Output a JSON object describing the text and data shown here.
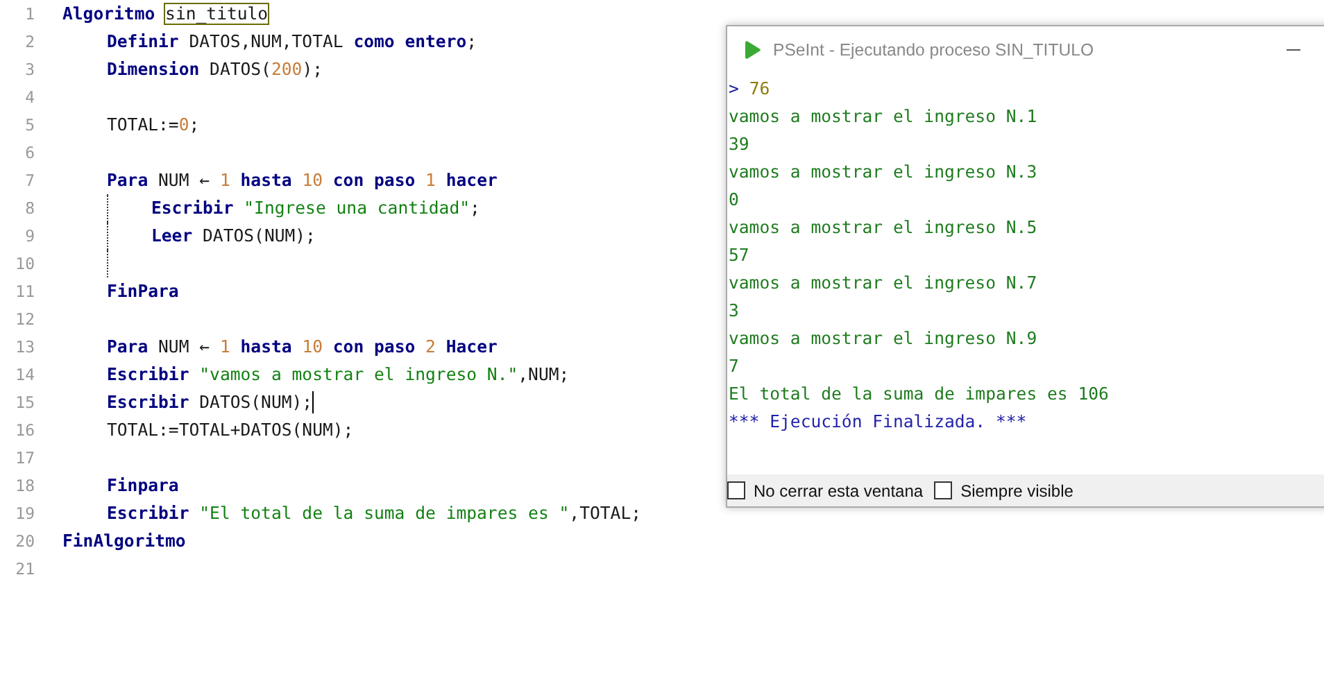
{
  "editor": {
    "lines": [
      {
        "number": "1",
        "tokens": [
          {
            "kind": "keyword",
            "text": "Algoritmo "
          },
          {
            "kind": "match",
            "text": "sin_titulo"
          }
        ],
        "children": [
          {
            "number": "2",
            "tokens": [
              {
                "kind": "keyword",
                "text": "Definir"
              },
              {
                "kind": "plain",
                "text": " DATOS,NUM,TOTAL "
              },
              {
                "kind": "keyword",
                "text": "como entero"
              },
              {
                "kind": "plain",
                "text": ";"
              }
            ]
          },
          {
            "number": "3",
            "tokens": [
              {
                "kind": "keyword",
                "text": "Dimension"
              },
              {
                "kind": "plain",
                "text": " DATOS("
              },
              {
                "kind": "number",
                "text": "200"
              },
              {
                "kind": "plain",
                "text": ");"
              }
            ]
          },
          {
            "number": "4"
          },
          {
            "number": "5",
            "tokens": [
              {
                "kind": "plain",
                "text": "TOTAL:="
              },
              {
                "kind": "number",
                "text": "0"
              },
              {
                "kind": "plain",
                "text": ";"
              }
            ]
          },
          {
            "number": "6"
          },
          {
            "number": "7",
            "tokens": [
              {
                "kind": "keyword",
                "text": "Para"
              },
              {
                "kind": "plain",
                "text": " NUM ← "
              },
              {
                "kind": "number",
                "text": "1 "
              },
              {
                "kind": "keyword",
                "text": "hasta "
              },
              {
                "kind": "number",
                "text": "10 "
              },
              {
                "kind": "keyword",
                "text": "con paso "
              },
              {
                "kind": "number",
                "text": "1 "
              },
              {
                "kind": "keyword",
                "text": "hacer"
              }
            ],
            "children": [
              {
                "number": "8",
                "tokens": [
                  {
                    "kind": "keyword",
                    "text": "Escribir "
                  },
                  {
                    "kind": "string",
                    "text": "\"Ingrese una cantidad\""
                  },
                  {
                    "kind": "plain",
                    "text": ";"
                  }
                ]
              },
              {
                "number": "9",
                "tokens": [
                  {
                    "kind": "keyword",
                    "text": "Leer"
                  },
                  {
                    "kind": "plain",
                    "text": " DATOS(NUM);"
                  }
                ]
              },
              {
                "number": "10"
              }
            ]
          },
          {
            "number": "11",
            "tokens": [
              {
                "kind": "keyword",
                "text": "FinPara"
              }
            ]
          },
          {
            "number": "12"
          },
          {
            "number": "13",
            "tokens": [
              {
                "kind": "keyword",
                "text": "Para"
              },
              {
                "kind": "plain",
                "text": " NUM ← "
              },
              {
                "kind": "number",
                "text": "1 "
              },
              {
                "kind": "keyword",
                "text": "hasta "
              },
              {
                "kind": "number",
                "text": "10 "
              },
              {
                "kind": "keyword",
                "text": "con paso "
              },
              {
                "kind": "number",
                "text": "2 "
              },
              {
                "kind": "keyword",
                "text": "Hacer"
              }
            ]
          },
          {
            "number": "14",
            "tokens": [
              {
                "kind": "keyword",
                "text": "Escribir "
              },
              {
                "kind": "string",
                "text": "\"vamos a mostrar el ingreso N.\""
              },
              {
                "kind": "plain",
                "text": ",NUM;"
              }
            ]
          },
          {
            "number": "15",
            "cursor": true,
            "tokens": [
              {
                "kind": "keyword",
                "text": "Escribir"
              },
              {
                "kind": "plain",
                "text": " DATOS(NUM);"
              }
            ]
          },
          {
            "number": "16",
            "tokens": [
              {
                "kind": "plain",
                "text": "TOTAL:=TOTAL+DATOS(NUM);"
              }
            ]
          },
          {
            "number": "17"
          },
          {
            "number": "18",
            "tokens": [
              {
                "kind": "keyword",
                "text": "Finpara"
              }
            ]
          },
          {
            "number": "19",
            "tokens": [
              {
                "kind": "keyword",
                "text": "Escribir "
              },
              {
                "kind": "string",
                "text": "\"El total de la suma de impares es \""
              },
              {
                "kind": "plain",
                "text": ",TOTAL;"
              }
            ]
          }
        ]
      },
      {
        "number": "20",
        "tokens": [
          {
            "kind": "keyword",
            "text": "FinAlgoritmo"
          }
        ]
      },
      {
        "number": "21"
      }
    ]
  },
  "console": {
    "title": "PSeInt - Ejecutando proceso SIN_TITULO",
    "lines": [
      {
        "kind": "input",
        "prompt": ">",
        "text": "76"
      },
      {
        "kind": "output",
        "text": "vamos a mostrar el ingreso N.1"
      },
      {
        "kind": "output",
        "text": "39"
      },
      {
        "kind": "output",
        "text": "vamos a mostrar el ingreso N.3"
      },
      {
        "kind": "output",
        "text": "0"
      },
      {
        "kind": "output",
        "text": "vamos a mostrar el ingreso N.5"
      },
      {
        "kind": "output",
        "text": "57"
      },
      {
        "kind": "output",
        "text": "vamos a mostrar el ingreso N.7"
      },
      {
        "kind": "output",
        "text": "3"
      },
      {
        "kind": "output",
        "text": "vamos a mostrar el ingreso N.9"
      },
      {
        "kind": "output",
        "text": "7"
      },
      {
        "kind": "output",
        "text": "El total de la suma de impares es 106"
      },
      {
        "kind": "info",
        "text": "*** Ejecución Finalizada. ***"
      }
    ],
    "options": [
      {
        "label": "No cerrar esta ventana",
        "checked": false
      },
      {
        "label": "Siempre visible",
        "checked": false
      }
    ]
  }
}
